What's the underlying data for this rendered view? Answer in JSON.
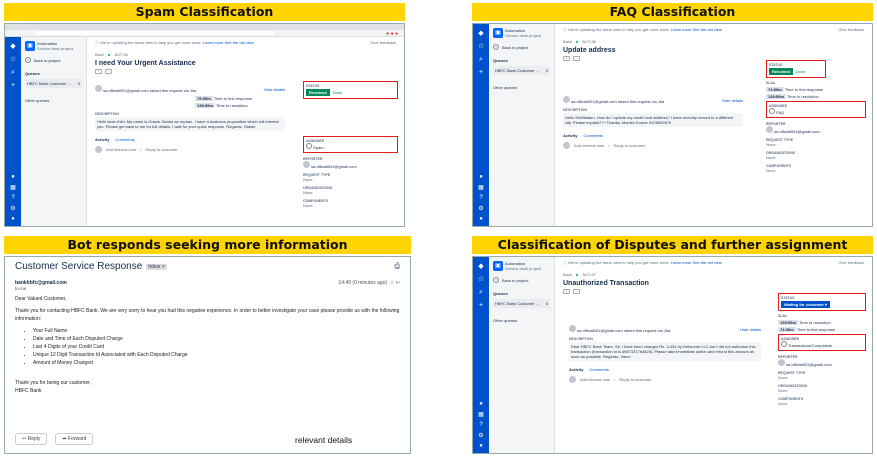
{
  "panels": {
    "tl_title": "Spam Classification",
    "tr_title": "FAQ Classification",
    "bl_title": "Bot responds seeking more information",
    "br_title": "Classification of Disputes and further assignment"
  },
  "jira": {
    "project_name": "Automation",
    "project_sub": "Service desk project",
    "back_to_project": "Back to project",
    "queues_heading": "Queues",
    "queue_name": "HBFC Bank Customer ...",
    "queue_count": "0",
    "other_queues": "Other queues",
    "notice": "We're updating the issue view to help you get more done.",
    "notice_link1": "Learn more",
    "notice_link2": "See the old view",
    "give_feedback": "Give feedback",
    "crumb_back": "Back",
    "sla_label": "SLAs",
    "sla_first_response": "Time to first response",
    "sla_resolution": "Time to resolution",
    "description_label": "DESCRIPTION",
    "activity": "Activity",
    "comments": "Comments",
    "add_internal_note": "Add internal note",
    "reply_to_customer": "Reply to customer",
    "status_label": "STATUS",
    "assignee_label": "ASSIGNEE",
    "reporter_label": "REPORTER",
    "request_type_label": "REQUEST TYPE",
    "organizations_label": "ORGANIZATIONS",
    "components_label": "COMPONENTS",
    "none": "None",
    "hide_details": "Hide details",
    "reporter_email": "sa.official001@gmail.com"
  },
  "spam": {
    "key": "AUT-95",
    "title": "I need Your Urgent Assistance",
    "raised": "sa.official001@gmail.com raised this request via Jira",
    "sla1": "75:59m",
    "sla2": "139:59m",
    "description": "Hello dear child, My name is Gracie Okafor an orphan. I have a business proposition which will interest you. Please get back to me for full details. I wait for your quick response. Regards, Gracie",
    "status": "Resolved",
    "done": "Done",
    "assignee": "Spam"
  },
  "faq": {
    "key": "AUT-96",
    "title": "Update address",
    "raised": "sa.official001@gmail.com raised this request via Jira",
    "sla1": "74:59m",
    "sla2": "139:59m",
    "description": "Hello Sir/Madam, How do I update my credit card address? I have recently moved to a different city. Please explain??? Thanks, Manish Kumar 9125000575",
    "status": "Resolved",
    "done": "Done",
    "assignee": "FAQ"
  },
  "dispute": {
    "key": "AUT-97",
    "title": "Unauthorized Transaction",
    "raised": "sa.official001@gmail.com raised this request via Jira",
    "sla1": "139:59m",
    "sla2": "74:59m",
    "description": "Dear HBFC Bank Team, Sir, I have been charged Rs. 3,451 by Delmonte LLC but I did not authorize this transaction (transaction id is #987321764825). Please take immediate action and refund this amount as soon as possible. Regards, Varun",
    "status": "Waiting for customer",
    "assignee": "Transactions/Complaints"
  },
  "email": {
    "subject": "Customer Service Response",
    "inbox": "Inbox",
    "from": "bankhbfc@gmail.com",
    "to": "to me",
    "time": "14:49 (0 minutes ago)",
    "greeting": "Dear Valued Customer,",
    "intro": "Thank you for contacting HBFC Bank. We are very sorry to hear you had this negative experience. In order to better investigate your case please provide us with the following information:",
    "items": [
      "Your Full Name",
      "Date and Time of Each Disputed Charge",
      "Last 4 Digits of your Credit Card",
      "Unique 12 Digit Transaction Id Associated with Each Disputed Charge",
      "Amount of Money Charged"
    ],
    "closing1": "Thank you for being our customer,",
    "closing2": "HBFC Bank",
    "reply": "Reply",
    "forward": "Forward",
    "annotation": "relevant details"
  }
}
